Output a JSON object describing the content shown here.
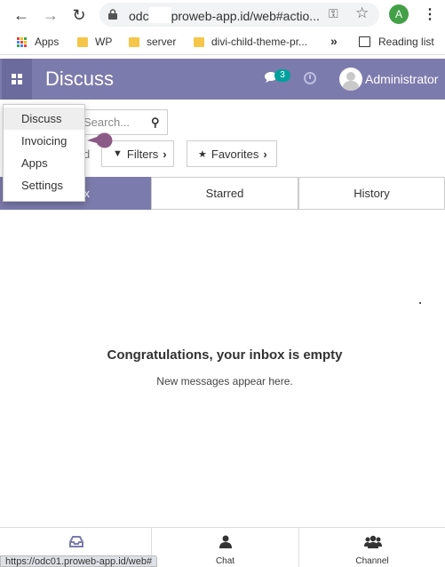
{
  "browser": {
    "url_prefix": "odc",
    "url_suffix": "proweb-app.id/web#actio...",
    "profile_initial": "A",
    "profile_color": "#43a047"
  },
  "bookmarks": [
    {
      "label": "Apps"
    },
    {
      "label": "WP"
    },
    {
      "label": "server"
    },
    {
      "label": "divi-child-theme-pr..."
    }
  ],
  "reading_list": "Reading list",
  "navbar": {
    "title": "Discuss",
    "chat_count": "3",
    "user": "Administrator",
    "accent": "#7c7bad"
  },
  "apps_menu": {
    "items": [
      {
        "label": "Discuss"
      },
      {
        "label": "Invoicing"
      },
      {
        "label": "Apps"
      },
      {
        "label": "Settings"
      }
    ]
  },
  "control_panel": {
    "search_placeholder": "Search...",
    "partial_label": "d",
    "filters_label": "Filters",
    "favorites_label": "Favorites"
  },
  "mailbox_tabs": [
    {
      "label": "x"
    },
    {
      "label": "Starred"
    },
    {
      "label": "History"
    }
  ],
  "empty": {
    "title": "Congratulations, your inbox is empty",
    "subtitle": "New messages appear here."
  },
  "bottom_nav": [
    {
      "label": ""
    },
    {
      "label": "Chat"
    },
    {
      "label": "Channel"
    }
  ],
  "status_url": "https://odc01.proweb-app.id/web#"
}
